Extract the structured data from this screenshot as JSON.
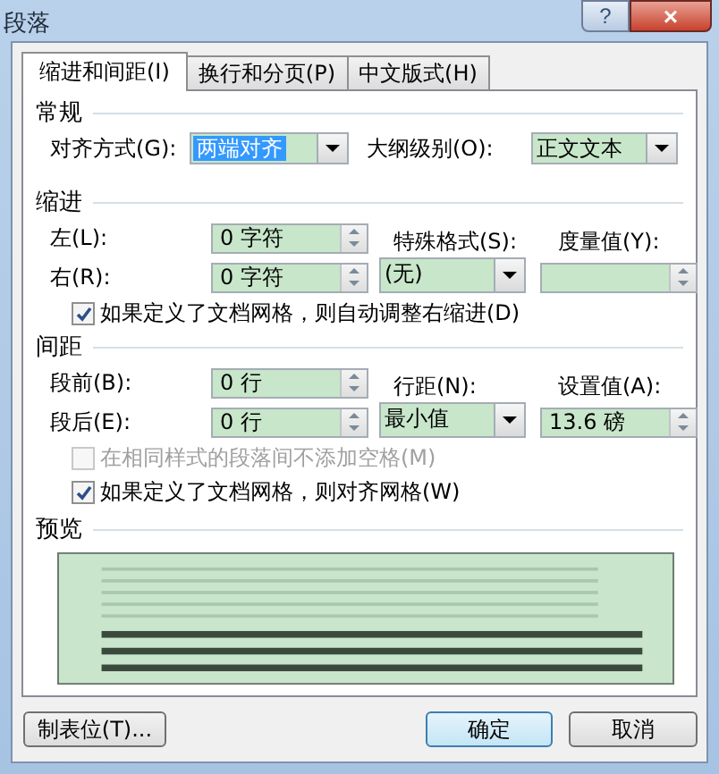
{
  "window": {
    "title": "段落",
    "help": "?",
    "close": "×"
  },
  "tabs": [
    {
      "label": "缩进和间距(I)",
      "selected": true
    },
    {
      "label": "换行和分页(P)",
      "selected": false
    },
    {
      "label": "中文版式(H)",
      "selected": false
    }
  ],
  "general": {
    "heading": "常规",
    "alignment": {
      "label": "对齐方式(G):",
      "value": "两端对齐",
      "focused": true
    },
    "outline_level": {
      "label": "大纲级别(O):",
      "value": "正文文本",
      "focused": false
    }
  },
  "indent": {
    "heading": "缩进",
    "left": {
      "label": "左(L):",
      "value": "0 字符"
    },
    "right": {
      "label": "右(R):",
      "value": "0 字符"
    },
    "special": {
      "label": "特殊格式(S):",
      "value": "(无)"
    },
    "measure": {
      "label": "度量值(Y):"
    },
    "checkbox": {
      "label": "如果定义了文档网格，则自动调整右缩进(D)",
      "checked": true,
      "disabled": false
    }
  },
  "spacing": {
    "heading": "间距",
    "before": {
      "label": "段前(B):",
      "value": "0 行"
    },
    "after": {
      "label": "段后(E):",
      "value": "0 行"
    },
    "line_spacing": {
      "label": "行距(N):",
      "value": "最小值"
    },
    "set_value": {
      "label": "设置值(A):",
      "value": "13.6 磅"
    },
    "checkboxes": [
      {
        "label": "在相同样式的段落间不添加空格(M)",
        "checked": false,
        "disabled": true
      },
      {
        "label": "如果定义了文档网格，则对齐网格(W)",
        "checked": true,
        "disabled": false
      }
    ]
  },
  "preview": {
    "heading": "预览"
  },
  "buttons": [
    {
      "label": "制表位(T)...",
      "default": false
    },
    {
      "label": "确定",
      "default": true
    },
    {
      "label": "取消",
      "default": false
    }
  ]
}
